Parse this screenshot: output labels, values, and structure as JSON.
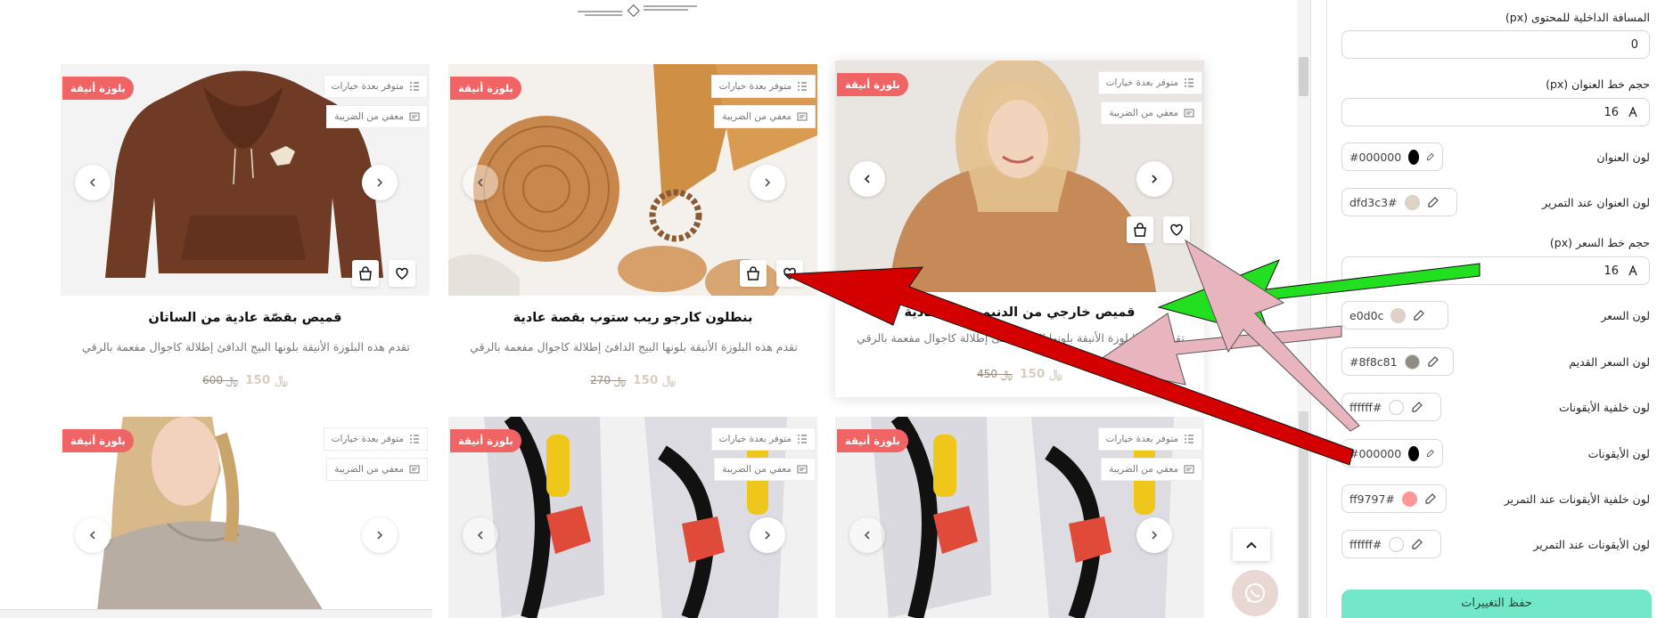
{
  "products": [
    {
      "title": "قميص خارجي من الدنيم بقصة عادية",
      "desc": "تقدم هذه البلوزة الأنيقة بلونها البيج الدافئ إطلالة كاجوال مفعمة بالرقي",
      "price": "150",
      "old_price": "450",
      "badge": "بلوزة أنيقة",
      "chip1": "متوفر بعدة خيارات",
      "chip2": "معفي من الضريبة"
    },
    {
      "title": "بنطلون كارجو ريب ستوب بقصة عادية",
      "desc": "تقدم هذه البلوزة الأنيقة بلونها البيج الدافئ إطلالة كاجوال مفعمة بالرقي",
      "price": "150",
      "old_price": "270",
      "badge": "بلوزة أنيقة",
      "chip1": "متوفر بعدة خيارات",
      "chip2": "معفي من الضريبة"
    },
    {
      "title": "قميص بقصّة عادية من الساتان",
      "desc": "تقدم هذه البلوزة الأنيقة بلونها البيج الدافئ إطلالة كاجوال مفعمة بالرقي",
      "price": "150",
      "old_price": "600",
      "badge": "بلوزة أنيقة",
      "chip1": "متوفر بعدة خيارات",
      "chip2": "معفي من الضريبة"
    },
    {
      "badge": "بلوزة أنيقة",
      "chip1": "متوفر بعدة خيارات",
      "chip2": "معفي من الضريبة"
    },
    {
      "badge": "بلوزة أنيقة",
      "chip1": "متوفر بعدة خيارات",
      "chip2": "معفي من الضريبة"
    },
    {
      "badge": "بلوزة أنيقة",
      "chip1": "متوفر بعدة خيارات",
      "chip2": "معفي من الضريبة"
    }
  ],
  "currency_symbol": "﷼",
  "settings": {
    "content_padding_label": "المسافة الداخلية للمحتوى (px)",
    "content_padding_value": "0",
    "title_font_label": "حجم خط العنوان (px)",
    "title_font_value": "16",
    "title_color_label": "لون العنوان",
    "title_color_value": "#000000",
    "title_hover_label": "لون العنوان عند التمرير",
    "title_hover_value": "dfd3c3#",
    "price_font_label": "حجم خط السعر (px)",
    "price_font_value": "16",
    "price_color_label": "لون السعر",
    "price_color_value": "e0d0c",
    "old_price_label": "لون السعر القديم",
    "old_price_value": "#8f8c81",
    "icons_bg_label": "لون خلفية الأيقونات",
    "icons_bg_value": "ffffff#",
    "icons_color_label": "لون الأيقونات",
    "icons_color_value": "#000000",
    "icons_bg_hover_label": "لون خلفية الأيقونات عند التمرير",
    "icons_bg_hover_value": "ff9797#",
    "icons_hover_label": "لون الأيقونات عند التمرير",
    "icons_hover_value": "ffffff#",
    "save_label": "حفظ التغييرات"
  },
  "colors": {
    "badge": "#f06465",
    "save": "#73e8c8",
    "swatch_black": "#000000",
    "swatch_title_hover": "#dfd3c3",
    "swatch_price": "#e0d0c8",
    "swatch_old": "#8f8c81",
    "swatch_white": "#ffffff",
    "swatch_pink": "#ff9797",
    "arrow_red": "#d40000",
    "arrow_green": "#22e01f",
    "arrow_pink": "#e8b4be"
  },
  "icons": [
    "list-icon",
    "tax-icon",
    "chevron-left-icon",
    "chevron-right-icon",
    "heart-icon",
    "bag-icon",
    "eyedropper-icon",
    "chevron-up-icon",
    "whatsapp-icon",
    "text-size-icon"
  ]
}
